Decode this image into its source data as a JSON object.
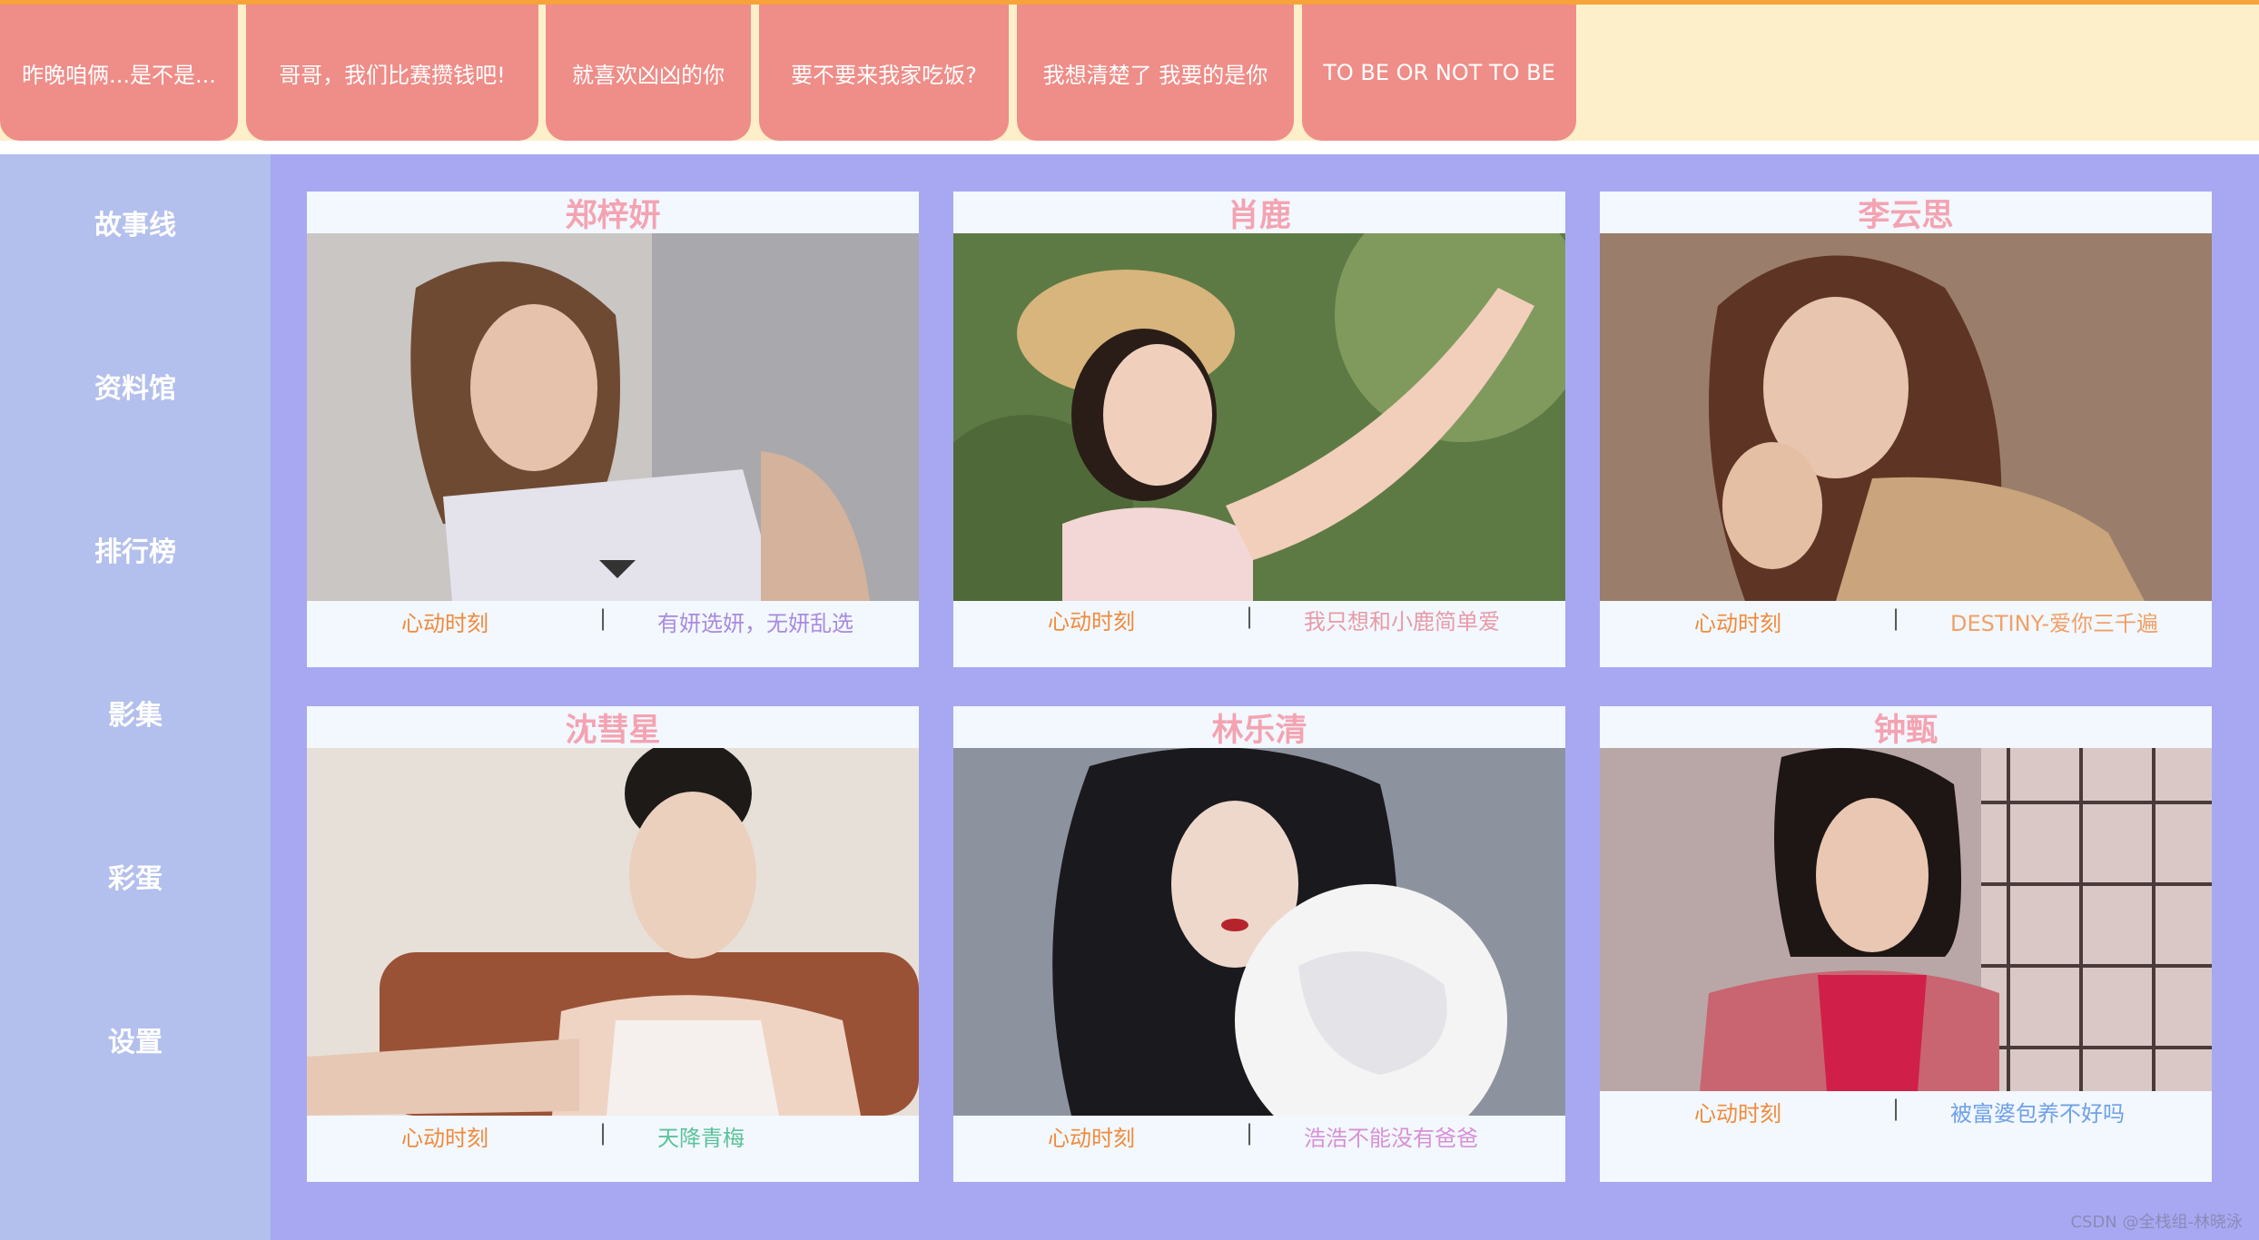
{
  "top_tabs": [
    {
      "label": "昨晚咱俩...是不是..."
    },
    {
      "label": "哥哥，我们比赛攒钱吧!"
    },
    {
      "label": "就喜欢凶凶的你"
    },
    {
      "label": "要不要来我家吃饭?"
    },
    {
      "label": "我想清楚了 我要的是你"
    },
    {
      "label": "TO BE OR NOT TO BE"
    }
  ],
  "sidebar": {
    "items": [
      {
        "label": "故事线"
      },
      {
        "label": "资料馆"
      },
      {
        "label": "排行榜"
      },
      {
        "label": "影集"
      },
      {
        "label": "彩蛋"
      },
      {
        "label": "设置"
      }
    ]
  },
  "cards": [
    {
      "name": "郑梓妍",
      "left_text": "心动时刻",
      "separator": "|",
      "right_text": "有妍选妍，无妍乱选",
      "right_color": "#a98ae0"
    },
    {
      "name": "肖鹿",
      "left_text": "心动时刻",
      "separator": "|",
      "right_text": "我只想和小鹿简单爱",
      "right_color": "#e89aa8"
    },
    {
      "name": "李云思",
      "left_text": "心动时刻",
      "separator": "|",
      "right_text": "DESTINY-爱你三千遍",
      "right_color": "#f0a068"
    },
    {
      "name": "沈彗星",
      "left_text": "心动时刻",
      "separator": "|",
      "right_text": "天降青梅",
      "right_color": "#5cc29a"
    },
    {
      "name": "林乐清",
      "left_text": "心动时刻",
      "separator": "|",
      "right_text": "浩浩不能没有爸爸",
      "right_color": "#d890d8"
    },
    {
      "name": "钟甄",
      "left_text": "心动时刻",
      "separator": "|",
      "right_text": "被富婆包养不好吗",
      "right_color": "#6fa0e8"
    }
  ],
  "watermark": "CSDN @全栈组-林晓泳",
  "colors": {
    "top_bar_bg": "#fdefc9",
    "top_tab_bg": "#ef8d88",
    "sidebar_bg": "#b3bfec",
    "main_bg": "#a8a8f2",
    "card_bg": "#f2f8fd",
    "card_name": "#f4a3b2",
    "left_text": "#f08a3c"
  }
}
